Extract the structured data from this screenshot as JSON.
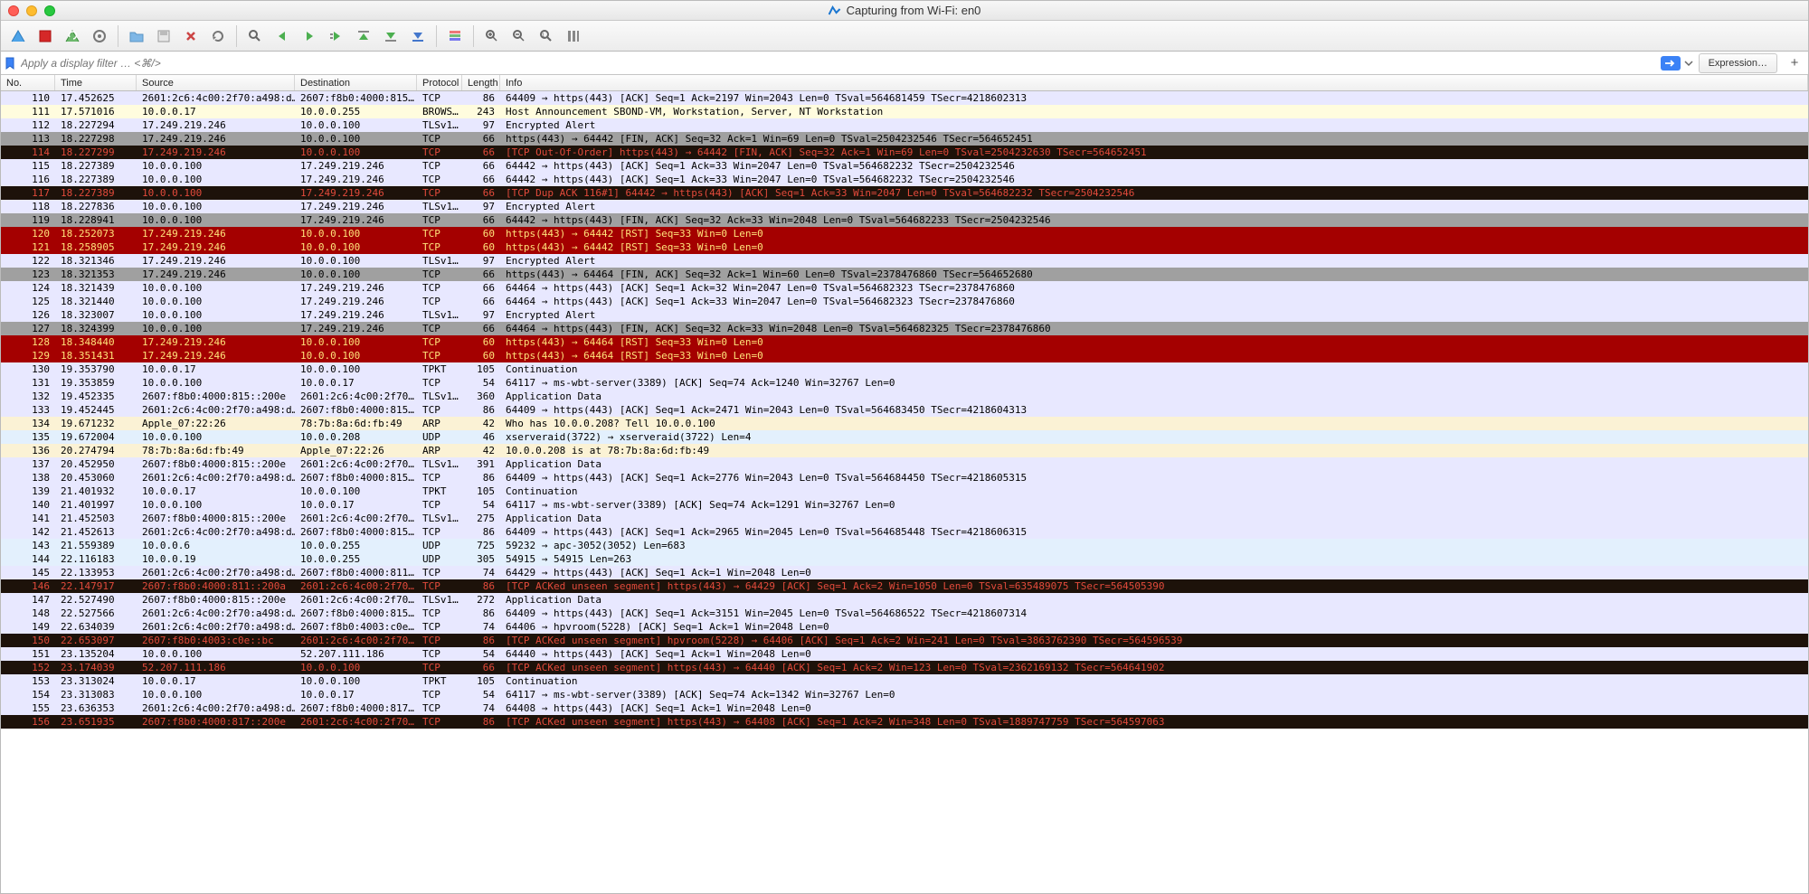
{
  "window_title": "Capturing from Wi-Fi: en0",
  "filter_placeholder": "Apply a display filter … <⌘/>",
  "expression_label": "Expression…",
  "columns": {
    "no": "No.",
    "time": "Time",
    "source": "Source",
    "destination": "Destination",
    "protocol": "Protocol",
    "length": "Length",
    "info": "Info"
  },
  "packets": [
    {
      "no": "110",
      "time": "17.452625",
      "src": "2601:2c6:4c00:2f70:a498:d…",
      "dst": "2607:f8b0:4000:815…",
      "proto": "TCP",
      "len": "86",
      "info": "64409 → https(443) [ACK] Seq=1 Ack=2197 Win=2043 Len=0 TSval=564681459 TSecr=4218602313",
      "cls": "lavender"
    },
    {
      "no": "111",
      "time": "17.571016",
      "src": "10.0.0.17",
      "dst": "10.0.0.255",
      "proto": "BROWS…",
      "len": "243",
      "info": "Host Announcement SBOND-VM, Workstation, Server, NT Workstation",
      "cls": "yellow"
    },
    {
      "no": "112",
      "time": "18.227294",
      "src": "17.249.219.246",
      "dst": "10.0.0.100",
      "proto": "TLSv1…",
      "len": "97",
      "info": "Encrypted Alert",
      "cls": "lavender"
    },
    {
      "no": "113",
      "time": "18.227298",
      "src": "17.249.219.246",
      "dst": "10.0.0.100",
      "proto": "TCP",
      "len": "66",
      "info": "https(443) → 64442 [FIN, ACK] Seq=32 Ack=1 Win=69 Len=0 TSval=2504232546 TSecr=564652451",
      "cls": "gray"
    },
    {
      "no": "114",
      "time": "18.227299",
      "src": "17.249.219.246",
      "dst": "10.0.0.100",
      "proto": "TCP",
      "len": "66",
      "info": "[TCP Out-Of-Order] https(443) → 64442 [FIN, ACK] Seq=32 Ack=1 Win=69 Len=0 TSval=2504232630 TSecr=564652451",
      "cls": "darkred"
    },
    {
      "no": "115",
      "time": "18.227389",
      "src": "10.0.0.100",
      "dst": "17.249.219.246",
      "proto": "TCP",
      "len": "66",
      "info": "64442 → https(443) [ACK] Seq=1 Ack=33 Win=2047 Len=0 TSval=564682232 TSecr=2504232546",
      "cls": "lavender"
    },
    {
      "no": "116",
      "time": "18.227389",
      "src": "10.0.0.100",
      "dst": "17.249.219.246",
      "proto": "TCP",
      "len": "66",
      "info": "64442 → https(443) [ACK] Seq=1 Ack=33 Win=2047 Len=0 TSval=564682232 TSecr=2504232546",
      "cls": "lavender"
    },
    {
      "no": "117",
      "time": "18.227389",
      "src": "10.0.0.100",
      "dst": "17.249.219.246",
      "proto": "TCP",
      "len": "66",
      "info": "[TCP Dup ACK 116#1] 64442 → https(443) [ACK] Seq=1 Ack=33 Win=2047 Len=0 TSval=564682232 TSecr=2504232546",
      "cls": "darkred"
    },
    {
      "no": "118",
      "time": "18.227836",
      "src": "10.0.0.100",
      "dst": "17.249.219.246",
      "proto": "TLSv1…",
      "len": "97",
      "info": "Encrypted Alert",
      "cls": "lavender"
    },
    {
      "no": "119",
      "time": "18.228941",
      "src": "10.0.0.100",
      "dst": "17.249.219.246",
      "proto": "TCP",
      "len": "66",
      "info": "64442 → https(443) [FIN, ACK] Seq=32 Ack=33 Win=2048 Len=0 TSval=564682233 TSecr=2504232546",
      "cls": "gray"
    },
    {
      "no": "120",
      "time": "18.252073",
      "src": "17.249.219.246",
      "dst": "10.0.0.100",
      "proto": "TCP",
      "len": "60",
      "info": "https(443) → 64442 [RST] Seq=33 Win=0 Len=0",
      "cls": "red"
    },
    {
      "no": "121",
      "time": "18.258905",
      "src": "17.249.219.246",
      "dst": "10.0.0.100",
      "proto": "TCP",
      "len": "60",
      "info": "https(443) → 64442 [RST] Seq=33 Win=0 Len=0",
      "cls": "red"
    },
    {
      "no": "122",
      "time": "18.321346",
      "src": "17.249.219.246",
      "dst": "10.0.0.100",
      "proto": "TLSv1…",
      "len": "97",
      "info": "Encrypted Alert",
      "cls": "lavender"
    },
    {
      "no": "123",
      "time": "18.321353",
      "src": "17.249.219.246",
      "dst": "10.0.0.100",
      "proto": "TCP",
      "len": "66",
      "info": "https(443) → 64464 [FIN, ACK] Seq=32 Ack=1 Win=60 Len=0 TSval=2378476860 TSecr=564652680",
      "cls": "gray"
    },
    {
      "no": "124",
      "time": "18.321439",
      "src": "10.0.0.100",
      "dst": "17.249.219.246",
      "proto": "TCP",
      "len": "66",
      "info": "64464 → https(443) [ACK] Seq=1 Ack=32 Win=2047 Len=0 TSval=564682323 TSecr=2378476860",
      "cls": "lavender"
    },
    {
      "no": "125",
      "time": "18.321440",
      "src": "10.0.0.100",
      "dst": "17.249.219.246",
      "proto": "TCP",
      "len": "66",
      "info": "64464 → https(443) [ACK] Seq=1 Ack=33 Win=2047 Len=0 TSval=564682323 TSecr=2378476860",
      "cls": "lavender"
    },
    {
      "no": "126",
      "time": "18.323007",
      "src": "10.0.0.100",
      "dst": "17.249.219.246",
      "proto": "TLSv1…",
      "len": "97",
      "info": "Encrypted Alert",
      "cls": "lavender"
    },
    {
      "no": "127",
      "time": "18.324399",
      "src": "10.0.0.100",
      "dst": "17.249.219.246",
      "proto": "TCP",
      "len": "66",
      "info": "64464 → https(443) [FIN, ACK] Seq=32 Ack=33 Win=2048 Len=0 TSval=564682325 TSecr=2378476860",
      "cls": "gray"
    },
    {
      "no": "128",
      "time": "18.348440",
      "src": "17.249.219.246",
      "dst": "10.0.0.100",
      "proto": "TCP",
      "len": "60",
      "info": "https(443) → 64464 [RST] Seq=33 Win=0 Len=0",
      "cls": "red"
    },
    {
      "no": "129",
      "time": "18.351431",
      "src": "17.249.219.246",
      "dst": "10.0.0.100",
      "proto": "TCP",
      "len": "60",
      "info": "https(443) → 64464 [RST] Seq=33 Win=0 Len=0",
      "cls": "red"
    },
    {
      "no": "130",
      "time": "19.353790",
      "src": "10.0.0.17",
      "dst": "10.0.0.100",
      "proto": "TPKT",
      "len": "105",
      "info": "Continuation",
      "cls": "lavender"
    },
    {
      "no": "131",
      "time": "19.353859",
      "src": "10.0.0.100",
      "dst": "10.0.0.17",
      "proto": "TCP",
      "len": "54",
      "info": "64117 → ms-wbt-server(3389) [ACK] Seq=74 Ack=1240 Win=32767 Len=0",
      "cls": "lavender"
    },
    {
      "no": "132",
      "time": "19.452335",
      "src": "2607:f8b0:4000:815::200e",
      "dst": "2601:2c6:4c00:2f70…",
      "proto": "TLSv1…",
      "len": "360",
      "info": "Application Data",
      "cls": "lavender"
    },
    {
      "no": "133",
      "time": "19.452445",
      "src": "2601:2c6:4c00:2f70:a498:d…",
      "dst": "2607:f8b0:4000:815…",
      "proto": "TCP",
      "len": "86",
      "info": "64409 → https(443) [ACK] Seq=1 Ack=2471 Win=2043 Len=0 TSval=564683450 TSecr=4218604313",
      "cls": "lavender"
    },
    {
      "no": "134",
      "time": "19.671232",
      "src": "Apple_07:22:26",
      "dst": "78:7b:8a:6d:fb:49",
      "proto": "ARP",
      "len": "42",
      "info": "Who has 10.0.0.208? Tell 10.0.0.100",
      "cls": "cream"
    },
    {
      "no": "135",
      "time": "19.672004",
      "src": "10.0.0.100",
      "dst": "10.0.0.208",
      "proto": "UDP",
      "len": "46",
      "info": "xserveraid(3722) → xserveraid(3722) Len=4",
      "cls": "lightblue"
    },
    {
      "no": "136",
      "time": "20.274794",
      "src": "78:7b:8a:6d:fb:49",
      "dst": "Apple_07:22:26",
      "proto": "ARP",
      "len": "42",
      "info": "10.0.0.208 is at 78:7b:8a:6d:fb:49",
      "cls": "cream"
    },
    {
      "no": "137",
      "time": "20.452950",
      "src": "2607:f8b0:4000:815::200e",
      "dst": "2601:2c6:4c00:2f70…",
      "proto": "TLSv1…",
      "len": "391",
      "info": "Application Data",
      "cls": "lavender"
    },
    {
      "no": "138",
      "time": "20.453060",
      "src": "2601:2c6:4c00:2f70:a498:d…",
      "dst": "2607:f8b0:4000:815…",
      "proto": "TCP",
      "len": "86",
      "info": "64409 → https(443) [ACK] Seq=1 Ack=2776 Win=2043 Len=0 TSval=564684450 TSecr=4218605315",
      "cls": "lavender"
    },
    {
      "no": "139",
      "time": "21.401932",
      "src": "10.0.0.17",
      "dst": "10.0.0.100",
      "proto": "TPKT",
      "len": "105",
      "info": "Continuation",
      "cls": "lavender"
    },
    {
      "no": "140",
      "time": "21.401997",
      "src": "10.0.0.100",
      "dst": "10.0.0.17",
      "proto": "TCP",
      "len": "54",
      "info": "64117 → ms-wbt-server(3389) [ACK] Seq=74 Ack=1291 Win=32767 Len=0",
      "cls": "lavender"
    },
    {
      "no": "141",
      "time": "21.452503",
      "src": "2607:f8b0:4000:815::200e",
      "dst": "2601:2c6:4c00:2f70…",
      "proto": "TLSv1…",
      "len": "275",
      "info": "Application Data",
      "cls": "lavender"
    },
    {
      "no": "142",
      "time": "21.452613",
      "src": "2601:2c6:4c00:2f70:a498:d…",
      "dst": "2607:f8b0:4000:815…",
      "proto": "TCP",
      "len": "86",
      "info": "64409 → https(443) [ACK] Seq=1 Ack=2965 Win=2045 Len=0 TSval=564685448 TSecr=4218606315",
      "cls": "lavender"
    },
    {
      "no": "143",
      "time": "21.559389",
      "src": "10.0.0.6",
      "dst": "10.0.0.255",
      "proto": "UDP",
      "len": "725",
      "info": "59232 → apc-3052(3052) Len=683",
      "cls": "lightblue"
    },
    {
      "no": "144",
      "time": "22.116183",
      "src": "10.0.0.19",
      "dst": "10.0.0.255",
      "proto": "UDP",
      "len": "305",
      "info": "54915 → 54915 Len=263",
      "cls": "lightblue"
    },
    {
      "no": "145",
      "time": "22.133953",
      "src": "2601:2c6:4c00:2f70:a498:d…",
      "dst": "2607:f8b0:4000:811…",
      "proto": "TCP",
      "len": "74",
      "info": "64429 → https(443) [ACK] Seq=1 Ack=1 Win=2048 Len=0",
      "cls": "lavender"
    },
    {
      "no": "146",
      "time": "22.147917",
      "src": "2607:f8b0:4000:811::200a",
      "dst": "2601:2c6:4c00:2f70…",
      "proto": "TCP",
      "len": "86",
      "info": "[TCP ACKed unseen segment] https(443) → 64429 [ACK] Seq=1 Ack=2 Win=1050 Len=0 TSval=635489075 TSecr=564505390",
      "cls": "darkred"
    },
    {
      "no": "147",
      "time": "22.527490",
      "src": "2607:f8b0:4000:815::200e",
      "dst": "2601:2c6:4c00:2f70…",
      "proto": "TLSv1…",
      "len": "272",
      "info": "Application Data",
      "cls": "lavender"
    },
    {
      "no": "148",
      "time": "22.527566",
      "src": "2601:2c6:4c00:2f70:a498:d…",
      "dst": "2607:f8b0:4000:815…",
      "proto": "TCP",
      "len": "86",
      "info": "64409 → https(443) [ACK] Seq=1 Ack=3151 Win=2045 Len=0 TSval=564686522 TSecr=4218607314",
      "cls": "lavender"
    },
    {
      "no": "149",
      "time": "22.634039",
      "src": "2601:2c6:4c00:2f70:a498:d…",
      "dst": "2607:f8b0:4003:c0e…",
      "proto": "TCP",
      "len": "74",
      "info": "64406 → hpvroom(5228) [ACK] Seq=1 Ack=1 Win=2048 Len=0",
      "cls": "lavender"
    },
    {
      "no": "150",
      "time": "22.653097",
      "src": "2607:f8b0:4003:c0e::bc",
      "dst": "2601:2c6:4c00:2f70…",
      "proto": "TCP",
      "len": "86",
      "info": "[TCP ACKed unseen segment] hpvroom(5228) → 64406 [ACK] Seq=1 Ack=2 Win=241 Len=0 TSval=3863762390 TSecr=564596539",
      "cls": "darkred"
    },
    {
      "no": "151",
      "time": "23.135204",
      "src": "10.0.0.100",
      "dst": "52.207.111.186",
      "proto": "TCP",
      "len": "54",
      "info": "64440 → https(443) [ACK] Seq=1 Ack=1 Win=2048 Len=0",
      "cls": "lavender"
    },
    {
      "no": "152",
      "time": "23.174039",
      "src": "52.207.111.186",
      "dst": "10.0.0.100",
      "proto": "TCP",
      "len": "66",
      "info": "[TCP ACKed unseen segment] https(443) → 64440 [ACK] Seq=1 Ack=2 Win=123 Len=0 TSval=2362169132 TSecr=564641902",
      "cls": "darkred"
    },
    {
      "no": "153",
      "time": "23.313024",
      "src": "10.0.0.17",
      "dst": "10.0.0.100",
      "proto": "TPKT",
      "len": "105",
      "info": "Continuation",
      "cls": "lavender"
    },
    {
      "no": "154",
      "time": "23.313083",
      "src": "10.0.0.100",
      "dst": "10.0.0.17",
      "proto": "TCP",
      "len": "54",
      "info": "64117 → ms-wbt-server(3389) [ACK] Seq=74 Ack=1342 Win=32767 Len=0",
      "cls": "lavender"
    },
    {
      "no": "155",
      "time": "23.636353",
      "src": "2601:2c6:4c00:2f70:a498:d…",
      "dst": "2607:f8b0:4000:817…",
      "proto": "TCP",
      "len": "74",
      "info": "64408 → https(443) [ACK] Seq=1 Ack=1 Win=2048 Len=0",
      "cls": "lavender"
    },
    {
      "no": "156",
      "time": "23.651935",
      "src": "2607:f8b0:4000:817::200e",
      "dst": "2601:2c6:4c00:2f70…",
      "proto": "TCP",
      "len": "86",
      "info": "[TCP ACKed unseen segment] https(443) → 64408 [ACK] Seq=1 Ack=2 Win=348 Len=0 TSval=1889747759 TSecr=564597063",
      "cls": "darkred"
    }
  ]
}
